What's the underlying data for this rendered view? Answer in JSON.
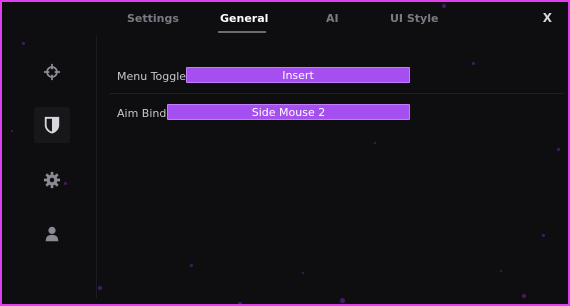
{
  "tabs": [
    {
      "label": "Settings",
      "active": false
    },
    {
      "label": "General",
      "active": true
    },
    {
      "label": "AI",
      "active": false
    },
    {
      "label": "UI Style",
      "active": false
    }
  ],
  "close_label": "X",
  "sidebar": {
    "items": [
      {
        "icon": "crosshair-icon",
        "active": false
      },
      {
        "icon": "shield-icon",
        "active": true
      },
      {
        "icon": "gear-icon",
        "active": false
      },
      {
        "icon": "user-icon",
        "active": false
      }
    ]
  },
  "settings": [
    {
      "label": "Menu Toggle",
      "value": "Insert"
    },
    {
      "label": "Aim Bind",
      "value": "Side Mouse 2"
    }
  ],
  "colors": {
    "frame_border": "#e040f0",
    "accent": "#a54ff0",
    "background": "#0e0e10"
  }
}
